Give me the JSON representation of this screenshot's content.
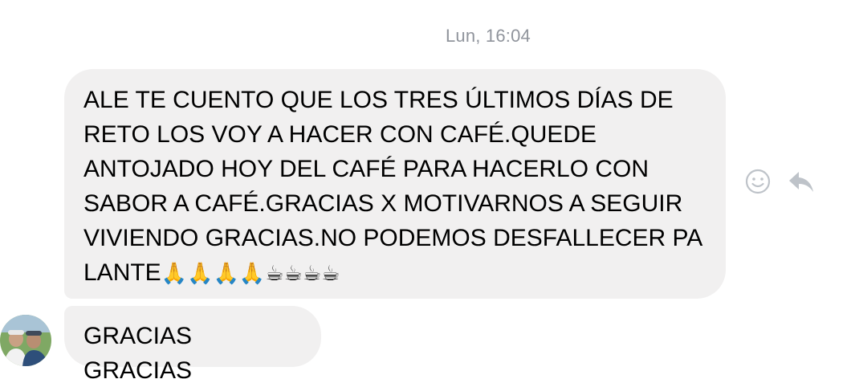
{
  "thread": {
    "timestamp": "Lun, 16:04",
    "messages": [
      {
        "text": "ALE TE CUENTO QUE LOS TRES ÚLTIMOS DÍAS DE\nRETO LOS VOY A HACER CON CAFÉ.QUEDE\nANTOJADO HOY DEL CAFÉ PARA HACERLO CON\nSABOR A CAFÉ.GRACIAS X MOTIVARNOS A SEGUIR\nVIVIENDO GRACIAS.NO PODEMOS DESFALLECER PA\nLANTE",
        "emoji": "🙏🙏🙏🙏☕☕☕☕"
      },
      {
        "text": "GRACIAS GRACIAS"
      }
    ],
    "actions": [
      {
        "icon": "smiley-icon"
      },
      {
        "icon": "reply-arrow-icon"
      }
    ],
    "colors": {
      "bubble": "#f1f0f0",
      "timestamp": "#90949c",
      "icon": "#bec3c9"
    }
  }
}
